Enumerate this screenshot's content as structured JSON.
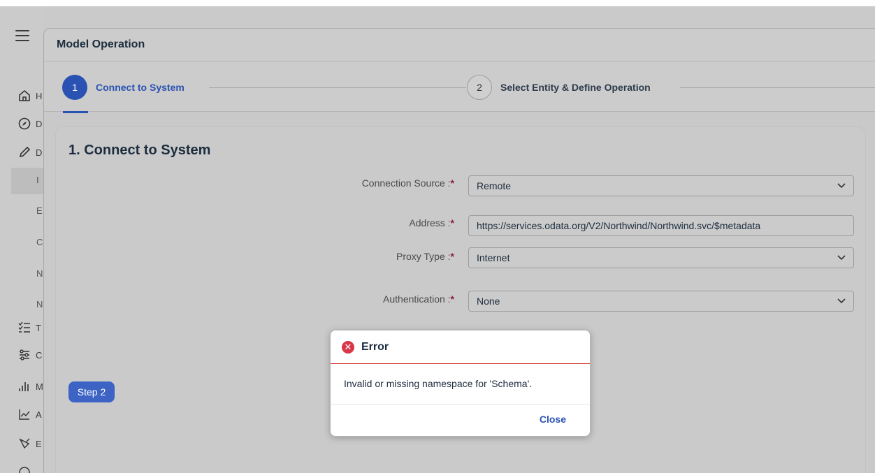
{
  "dialog": {
    "title": "Model Operation"
  },
  "wizard": {
    "steps": [
      {
        "number": "1",
        "label": "Connect to System"
      },
      {
        "number": "2",
        "label": "Select Entity & Define Operation"
      }
    ]
  },
  "form": {
    "section_title": "1. Connect to System",
    "connection_source": {
      "label": "Connection Source :",
      "value": "Remote"
    },
    "address": {
      "label": "Address :",
      "value": "https://services.odata.org/V2/Northwind/Northwind.svc/$metadata"
    },
    "proxy_type": {
      "label": "Proxy Type :",
      "value": "Internet"
    },
    "authentication": {
      "label": "Authentication :",
      "value": "None"
    },
    "required_mark": "*",
    "step2_button": "Step 2"
  },
  "sidenav": {
    "letters": [
      "H",
      "D",
      "D",
      "I",
      "E",
      "C",
      "N",
      "N",
      "T",
      "C",
      "M",
      "A",
      "E"
    ]
  },
  "error_popup": {
    "title": "Error",
    "message": "Invalid or missing namespace for 'Schema'.",
    "close_label": "Close",
    "icon_glyph": "✕"
  },
  "icons": {
    "dropdown": "chevron-down-icon",
    "error": "error-icon"
  }
}
